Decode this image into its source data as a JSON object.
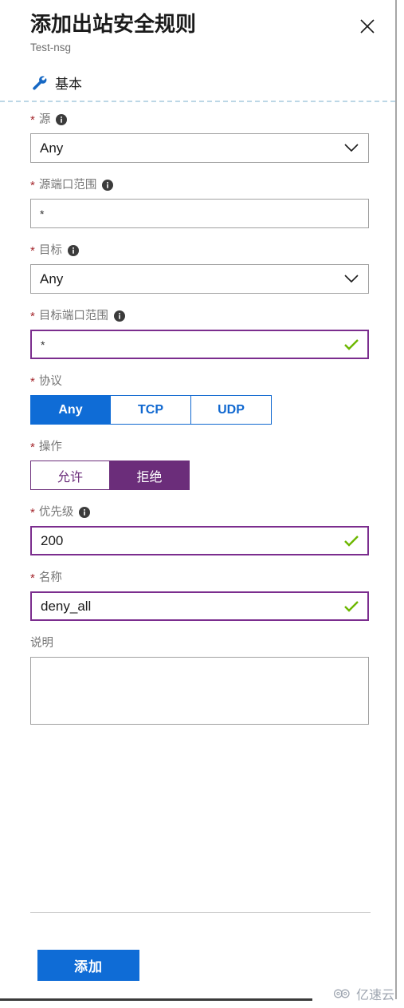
{
  "blade": {
    "title": "添加出站安全规则",
    "subtitle": "Test-nsg",
    "close_label": "×",
    "section": {
      "icon": "wrench-icon",
      "label": "基本"
    }
  },
  "form": {
    "source": {
      "label": "源",
      "required": "*",
      "info": "info-icon",
      "value": "Any",
      "control": "dropdown"
    },
    "source_port_ranges": {
      "label": "源端口范围",
      "required": "*",
      "info": "info-icon",
      "value": "*",
      "control": "textbox"
    },
    "destination": {
      "label": "目标",
      "required": "*",
      "info": "info-icon",
      "value": "Any",
      "control": "dropdown"
    },
    "destination_port_ranges": {
      "label": "目标端口范围",
      "required": "*",
      "info": "info-icon",
      "value": "*",
      "control": "textbox",
      "validated": "true"
    },
    "protocol": {
      "label": "协议",
      "required": "*",
      "options": [
        "Any",
        "TCP",
        "UDP"
      ],
      "selected": "Any"
    },
    "action": {
      "label": "操作",
      "required": "*",
      "options": [
        "允许",
        "拒绝"
      ],
      "selected": "拒绝"
    },
    "priority": {
      "label": "优先级",
      "required": "*",
      "info": "info-icon",
      "value": "200",
      "control": "textbox",
      "validated": "true"
    },
    "name": {
      "label": "名称",
      "required": "*",
      "value": "deny_all",
      "control": "textbox",
      "validated": "true"
    },
    "description": {
      "label": "说明",
      "value": "",
      "placeholder": "",
      "control": "textarea"
    }
  },
  "footer": {
    "submit_label": "添加"
  },
  "watermark": {
    "text": "亿速云",
    "icon": "cloud-icon"
  },
  "colors": {
    "accent_blue": "#0f6cd6",
    "action_purple": "#6b2d7a",
    "validated_border": "#7b2d8e",
    "check_green": "#6cb700",
    "required_red": "#a4262c",
    "label_gray": "#767676"
  }
}
